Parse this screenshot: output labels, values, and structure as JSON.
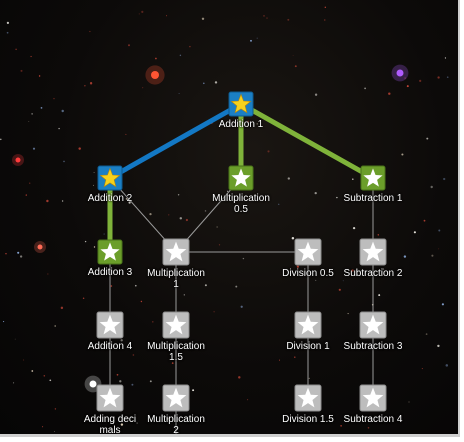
{
  "colors": {
    "done_bg": "#1b7fc4",
    "done_border": "#0e5a8f",
    "done_star": "#f7d21c",
    "available_bg": "#6b9e2a",
    "available_border": "#4a7319",
    "locked_bg": "#bdbdbd",
    "locked_border": "#8c8c8c",
    "star_white": "#ffffff",
    "edge_done": "#1378c4",
    "edge_available": "#7fb33a",
    "edge_locked": "#9a9a9a"
  },
  "nodes": [
    {
      "id": "addition-1",
      "label": "Addition 1",
      "state": "completed",
      "icon": "gold-star-icon"
    },
    {
      "id": "addition-2",
      "label": "Addition 2",
      "state": "completed",
      "icon": "gold-star-icon"
    },
    {
      "id": "multiplication-0-5",
      "label": "Multiplication 0.5",
      "state": "available",
      "icon": "white-star-icon"
    },
    {
      "id": "subtraction-1",
      "label": "Subtraction 1",
      "state": "available",
      "icon": "white-star-icon"
    },
    {
      "id": "addition-3",
      "label": "Addition 3",
      "state": "available",
      "icon": "white-star-icon"
    },
    {
      "id": "multiplication-1",
      "label": "Multiplication 1",
      "state": "locked",
      "icon": "white-star-icon"
    },
    {
      "id": "division-0-5",
      "label": "Division 0.5",
      "state": "locked",
      "icon": "white-star-icon"
    },
    {
      "id": "subtraction-2",
      "label": "Subtraction 2",
      "state": "locked",
      "icon": "white-star-icon"
    },
    {
      "id": "addition-4",
      "label": "Addition 4",
      "state": "locked",
      "icon": "white-star-icon"
    },
    {
      "id": "multiplication-1-5",
      "label": "Multiplication 1.5",
      "state": "locked",
      "icon": "white-star-icon"
    },
    {
      "id": "division-1",
      "label": "Division 1",
      "state": "locked",
      "icon": "white-star-icon"
    },
    {
      "id": "subtraction-3",
      "label": "Subtraction 3",
      "state": "locked",
      "icon": "white-star-icon"
    },
    {
      "id": "adding-decimals",
      "label": "Adding decimals",
      "state": "locked",
      "icon": "white-star-icon"
    },
    {
      "id": "multiplication-2",
      "label": "Multiplication 2",
      "state": "locked",
      "icon": "white-star-icon"
    },
    {
      "id": "division-1-5",
      "label": "Division 1.5",
      "state": "locked",
      "icon": "white-star-icon"
    },
    {
      "id": "subtraction-4",
      "label": "Subtraction 4",
      "state": "locked",
      "icon": "white-star-icon"
    }
  ],
  "edges": [
    {
      "from": "addition-1",
      "to": "addition-2",
      "state": "completed"
    },
    {
      "from": "addition-1",
      "to": "multiplication-0-5",
      "state": "available"
    },
    {
      "from": "addition-1",
      "to": "subtraction-1",
      "state": "available"
    },
    {
      "from": "addition-2",
      "to": "addition-3",
      "state": "available"
    },
    {
      "from": "addition-2",
      "to": "multiplication-1",
      "state": "locked"
    },
    {
      "from": "multiplication-0-5",
      "to": "multiplication-1",
      "state": "locked"
    },
    {
      "from": "multiplication-1",
      "to": "division-0-5",
      "state": "locked"
    },
    {
      "from": "subtraction-1",
      "to": "subtraction-2",
      "state": "locked"
    },
    {
      "from": "addition-3",
      "to": "addition-4",
      "state": "locked"
    },
    {
      "from": "multiplication-1",
      "to": "multiplication-1-5",
      "state": "locked"
    },
    {
      "from": "division-0-5",
      "to": "division-1",
      "state": "locked"
    },
    {
      "from": "subtraction-2",
      "to": "subtraction-3",
      "state": "locked"
    },
    {
      "from": "addition-4",
      "to": "adding-decimals",
      "state": "locked"
    },
    {
      "from": "multiplication-1-5",
      "to": "multiplication-2",
      "state": "locked"
    },
    {
      "from": "division-1",
      "to": "division-1-5",
      "state": "locked"
    },
    {
      "from": "subtraction-3",
      "to": "subtraction-4",
      "state": "locked"
    }
  ]
}
